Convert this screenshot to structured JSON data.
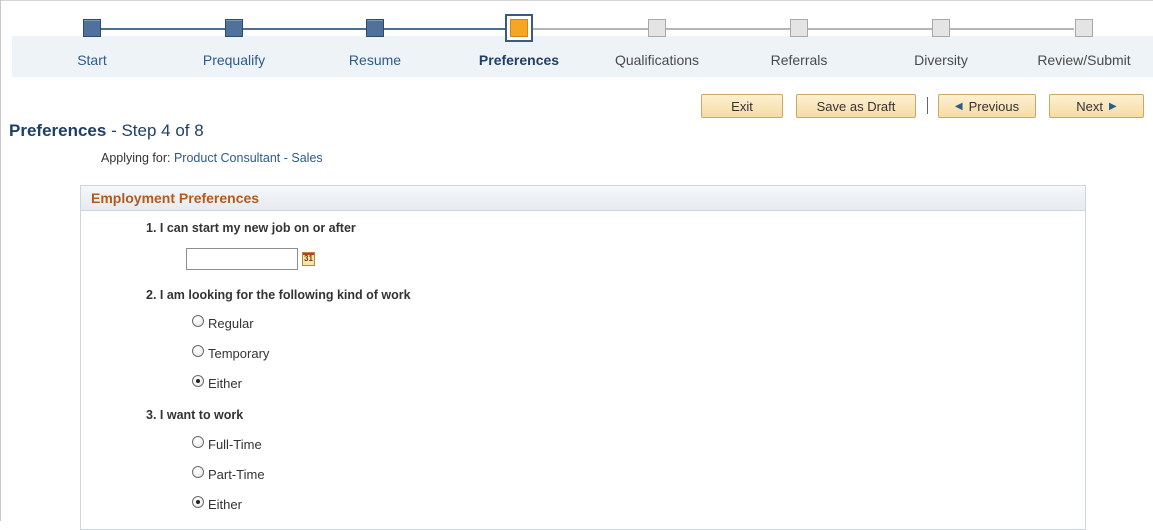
{
  "train": {
    "steps": [
      {
        "label": "Start",
        "state": "done"
      },
      {
        "label": "Prequalify",
        "state": "done"
      },
      {
        "label": "Resume",
        "state": "done"
      },
      {
        "label": "Preferences",
        "state": "current"
      },
      {
        "label": "Qualifications",
        "state": "todo"
      },
      {
        "label": "Referrals",
        "state": "todo"
      },
      {
        "label": "Diversity",
        "state": "todo"
      },
      {
        "label": "Review/Submit",
        "state": "todo"
      }
    ]
  },
  "toolbar": {
    "exit_label": "Exit",
    "save_draft_label": "Save as Draft",
    "previous_label": "Previous",
    "next_label": "Next"
  },
  "page": {
    "title": "Preferences",
    "step_text": " - Step 4 of 8",
    "applying_prefix": "Applying for: ",
    "job_link": "Product Consultant - Sales"
  },
  "section": {
    "title": "Employment Preferences",
    "q1": {
      "label": "1. I can start my new job on or after",
      "value": "",
      "calendar_icon_text": "31"
    },
    "q2": {
      "label": "2. I am looking for the following kind of work",
      "options": [
        "Regular",
        "Temporary",
        "Either"
      ],
      "selected": "Either"
    },
    "q3": {
      "label": "3. I want to work",
      "options": [
        "Full-Time",
        "Part-Time",
        "Either"
      ],
      "selected": "Either"
    }
  },
  "colors": {
    "accent": "#2c5b8c",
    "section_title": "#b55a1f",
    "current_step": "#f5a623",
    "button_fill": "#f6dca4"
  }
}
